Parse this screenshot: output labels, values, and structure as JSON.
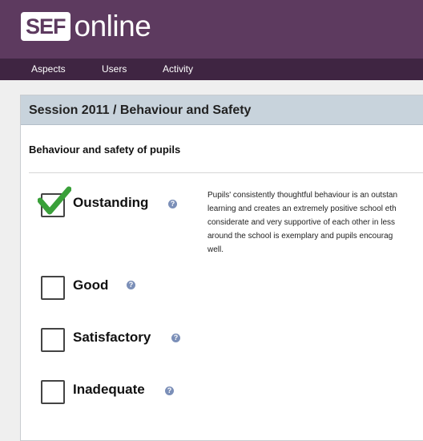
{
  "app": {
    "logo_box": "SEF",
    "logo_text": "online"
  },
  "nav": {
    "items": [
      {
        "label": "Aspects"
      },
      {
        "label": "Users"
      },
      {
        "label": "Activity"
      }
    ]
  },
  "panel": {
    "title": "Session 2011 / Behaviour and Safety",
    "section_title": "Behaviour and safety of pupils",
    "options": [
      {
        "label": "Oustanding",
        "checked": true
      },
      {
        "label": "Good",
        "checked": false
      },
      {
        "label": "Satisfactory",
        "checked": false
      },
      {
        "label": "Inadequate",
        "checked": false
      }
    ],
    "help_glyph": "?",
    "description_lines": [
      "Pupils' consistently thoughtful behaviour is an outstan",
      "learning and creates an extremely positive school eth",
      "considerate and very supportive of each other in less",
      "around the school is exemplary and pupils encourag",
      "well."
    ]
  },
  "colors": {
    "header": "#5d3a5f",
    "nav": "#3f2542",
    "panel_head": "#c8d3dc",
    "check": "#3aa03a",
    "help": "#7b8fb8"
  }
}
